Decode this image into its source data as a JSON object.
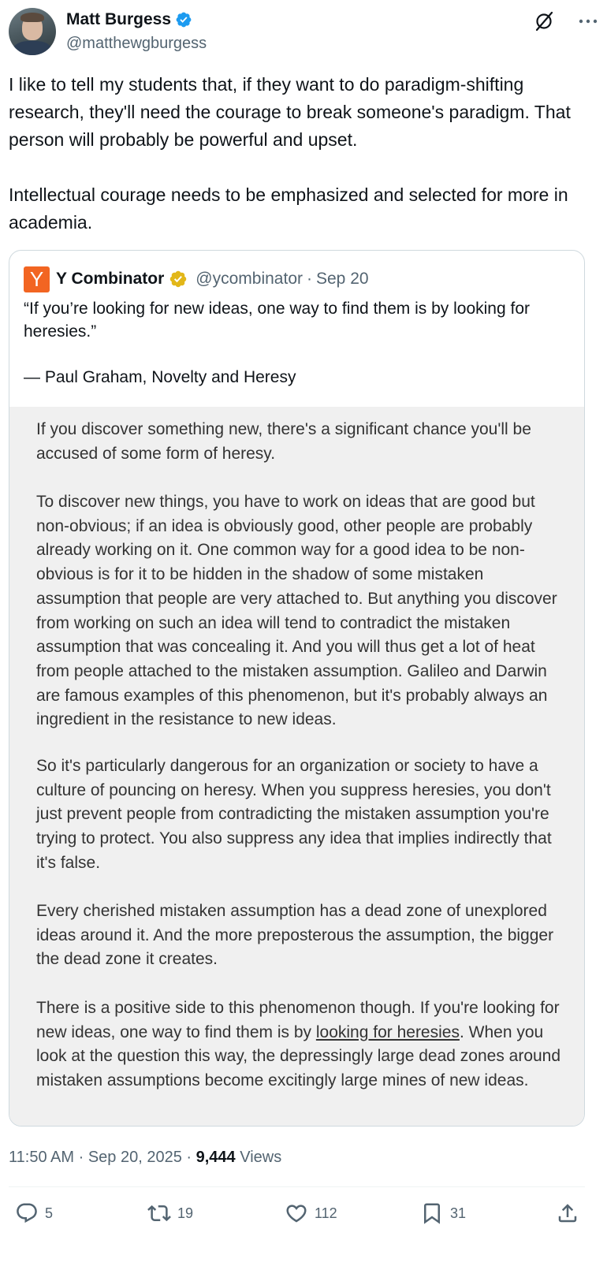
{
  "author": {
    "display_name": "Matt Burgess",
    "handle": "@matthewgburgess"
  },
  "tweet": {
    "text": "I like to tell my students that, if they want to do paradigm-shifting research, they'll need the courage to break someone's paradigm. That person will probably be powerful and upset.\n\nIntellectual courage needs to be emphasized and selected for more in academia."
  },
  "quote": {
    "logo_letter": "Y",
    "display_name": "Y Combinator",
    "handle": "@ycombinator",
    "separator": "·",
    "date": "Sep 20",
    "text": "“If you’re looking for new ideas, one way to find them is by looking for heresies.”\n\n— Paul Graham, Novelty and Heresy",
    "essay": {
      "p1": "If you discover something new, there's a significant chance you'll be accused of some form of heresy.",
      "p2": "To discover new things, you have to work on ideas that are good but non-obvious; if an idea is obviously good, other people are probably already working on it. One common way for a good idea to be non-obvious is for it to be hidden in the shadow of some mistaken assumption that people are very attached to. But anything you discover from working on such an idea will tend to contradict the mistaken assumption that was concealing it. And you will thus get a lot of heat from people attached to the mistaken assumption. Galileo and Darwin are famous examples of this phenomenon, but it's probably always an ingredient in the resistance to new ideas.",
      "p3": "So it's particularly dangerous for an organization or society to have a culture of pouncing on heresy. When you suppress heresies, you don't just prevent people from contradicting the mistaken assumption you're trying to protect. You also suppress any idea that implies indirectly that it's false.",
      "p4": "Every cherished mistaken assumption has a dead zone of unexplored ideas around it. And the more preposterous the assumption, the bigger the dead zone it creates.",
      "p5_before": "There is a positive side to this phenomenon though. If you're looking for new ideas, one way to find them is by ",
      "p5_link": "looking for heresies",
      "p5_after": ". When you look at the question this way, the depressingly large dead zones around mistaken assumptions become excitingly large mines of new ideas."
    }
  },
  "meta": {
    "time": "11:50 AM",
    "sep1": "·",
    "date": "Sep 20, 2025",
    "sep2": "·",
    "views_count": "9,444",
    "views_label": "Views"
  },
  "actions": {
    "replies": "5",
    "reposts": "19",
    "likes": "112",
    "bookmarks": "31"
  },
  "icons": {
    "verified": "verified-badge-icon",
    "gold_verified": "gold-verified-badge-icon",
    "grok": "grok-icon",
    "more": "more-icon",
    "reply": "reply-icon",
    "repost": "repost-icon",
    "like": "heart-icon",
    "bookmark": "bookmark-icon",
    "share": "share-icon"
  },
  "colors": {
    "blue_verified": "#1d9bf0",
    "gold_verified": "#e2b719",
    "yc_orange": "#f26522",
    "secondary_text": "#536471"
  }
}
